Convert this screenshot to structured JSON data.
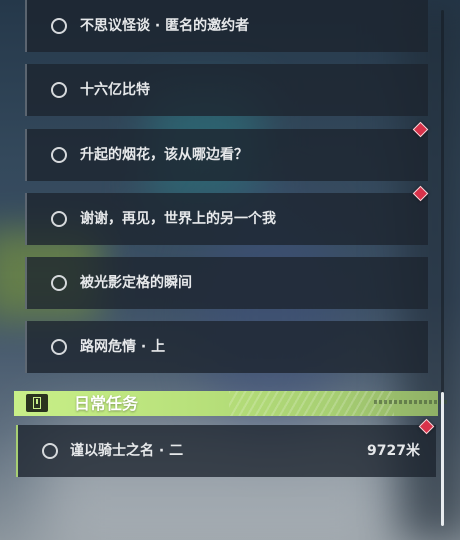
{
  "quests": [
    {
      "name": "不思议怪谈 · 匿名的邀约者",
      "tracked": false
    },
    {
      "name": "十六亿比特",
      "tracked": false
    },
    {
      "name": "升起的烟花，该从哪边看？",
      "tracked": true
    },
    {
      "name": "谢谢，再见，世界上的另一个我",
      "tracked": true
    },
    {
      "name": "被光影定格的瞬间",
      "tracked": false
    },
    {
      "name": "路网危情 · 上",
      "tracked": false
    }
  ],
  "daily_section": {
    "title": "日常任务",
    "icon": "exclamation-square-icon",
    "quests": [
      {
        "name": "谨以骑士之名 · 二",
        "distance": "9727米",
        "tracked": true
      }
    ]
  },
  "colors": {
    "daily_accent": "#c8ef88",
    "marker": "#d8324a"
  }
}
